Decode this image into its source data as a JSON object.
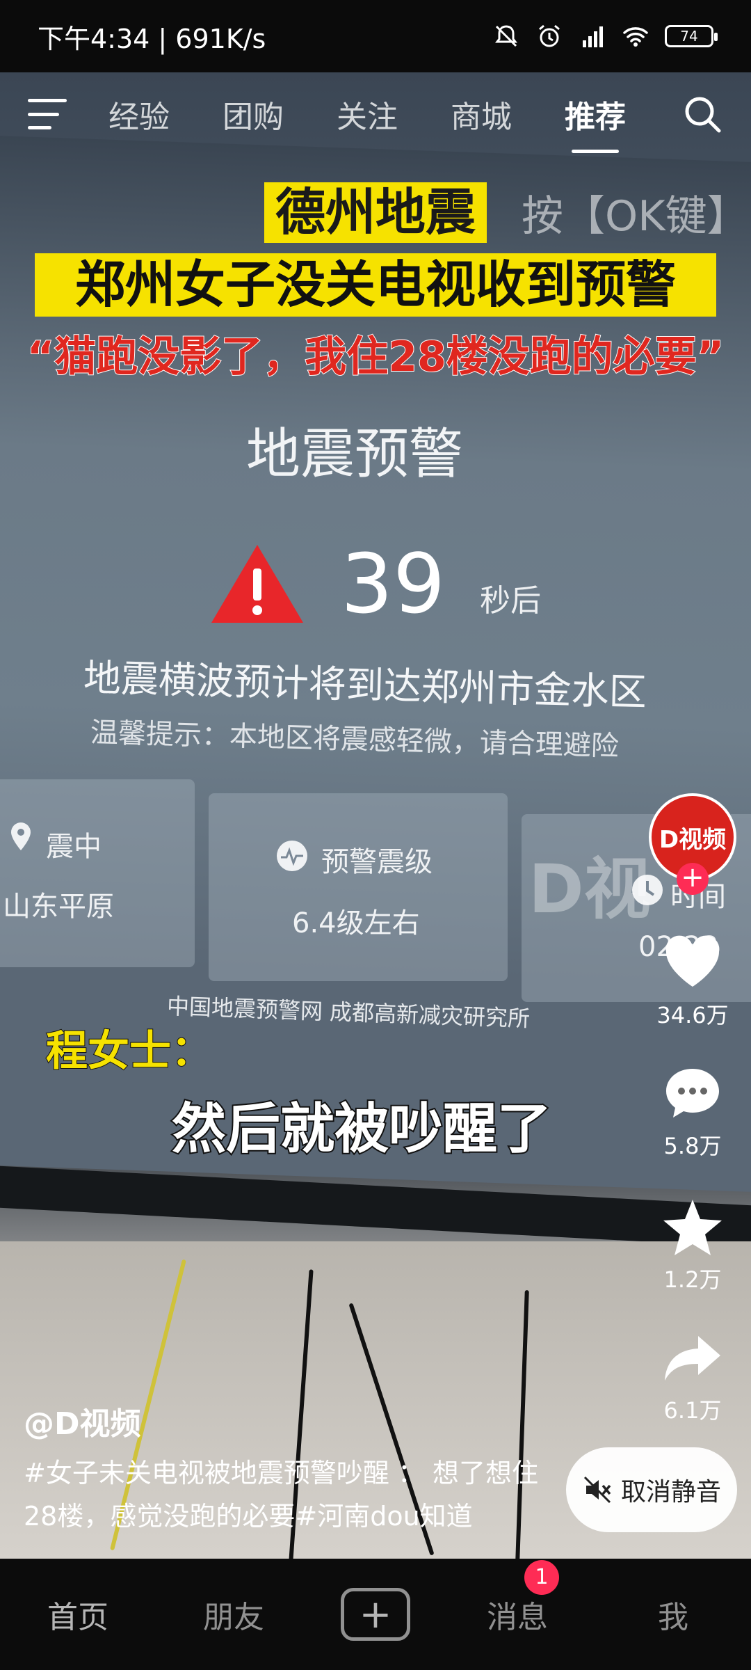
{
  "status_bar": {
    "time_speed": "下午4:34 | 691K/s",
    "battery": "74"
  },
  "top_nav": {
    "tabs": [
      "经验",
      "团购",
      "关注",
      "商城",
      "推荐"
    ],
    "active_tab": "推荐"
  },
  "overlay": {
    "headline_1": "德州地震",
    "ok_hint": "按【OK键】",
    "headline_2": "郑州女子没关电视收到预警",
    "headline_3": "“猫跑没影了，我住28楼没跑的必要”"
  },
  "tv_screen": {
    "title": "地震预警",
    "countdown": "39",
    "seconds_label": "秒后",
    "line_1": "地震横波预计将到达郑州市金水区",
    "line_2": "温馨提示：本地区将震感轻微，请合理避险",
    "card_epicenter_label": "震中",
    "card_epicenter_value": "山东平原",
    "card_magnitude_label": "预警震级",
    "card_magnitude_value": "6.4级左右",
    "card_time_label": "时间",
    "card_time_value": "02:33",
    "watermark": "D视",
    "source": "中国地震预警网 成都高新减灾研究所"
  },
  "subtitles": {
    "speaker": "程女士：",
    "line": "然后就被吵醒了"
  },
  "right_rail": {
    "avatar_text": "D视频",
    "likes": "34.6万",
    "comments": "5.8万",
    "favorites": "1.2万",
    "shares": "6.1万"
  },
  "caption": {
    "author": "@D视频",
    "description": "#女子未关电视被地震预警吵醒 ： 想了想住28楼，感觉没跑的必要#河南dou知道",
    "unmute_label": "取消静音"
  },
  "bottom_nav": {
    "home": "首页",
    "friends": "朋友",
    "messages": "消息",
    "messages_badge": "1",
    "me": "我"
  }
}
